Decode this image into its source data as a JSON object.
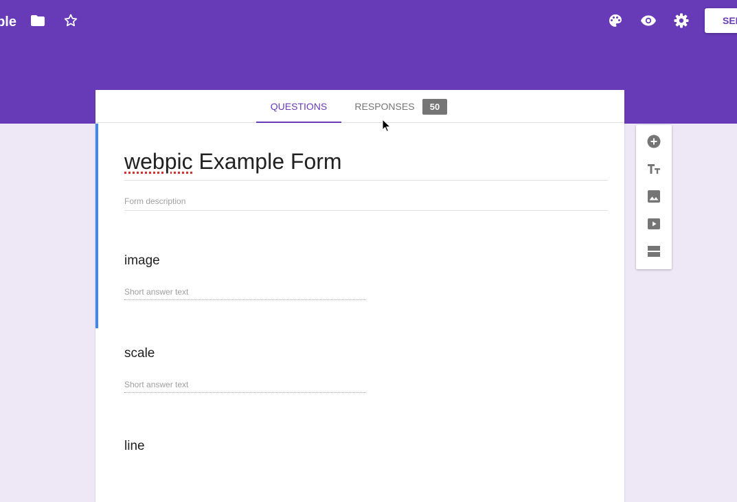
{
  "app": {
    "title": "webpic Example"
  },
  "header": {
    "icons": [
      "folder-icon",
      "star-outline-icon",
      "palette-icon",
      "eye-icon",
      "gear-icon"
    ],
    "send_label": "SEND"
  },
  "colors": {
    "theme": "#673ab7",
    "background": "#ede7f6",
    "focus_accent": "#4285f4"
  },
  "tabs": {
    "questions_label": "QUESTIONS",
    "responses_label": "RESPONSES",
    "responses_count": "50",
    "active": "QUESTIONS"
  },
  "form": {
    "title_spell": "webpic",
    "title_rest": " Example Form",
    "description_placeholder": "Form description"
  },
  "questions": [
    {
      "title": "image",
      "answer_placeholder": "Short answer text"
    },
    {
      "title": "scale",
      "answer_placeholder": "Short answer text"
    },
    {
      "title": "line"
    }
  ],
  "toolbar": {
    "icons": [
      "add-circle-icon",
      "title-text-icon",
      "image-icon",
      "video-icon",
      "section-icon"
    ]
  }
}
